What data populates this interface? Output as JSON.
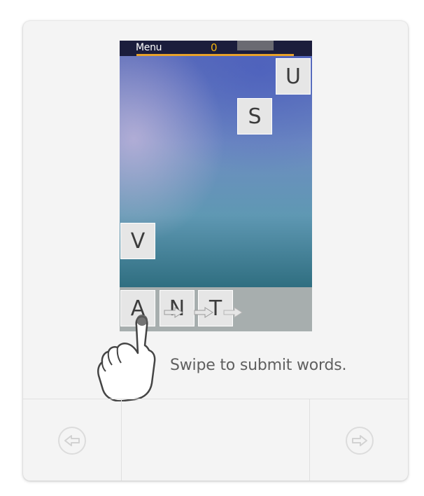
{
  "game": {
    "menu_label": "Menu",
    "score": "0",
    "falling_tiles": [
      {
        "letter": "U"
      },
      {
        "letter": "S"
      },
      {
        "letter": "V"
      }
    ],
    "tray_tiles": [
      {
        "letter": "A"
      },
      {
        "letter": "N"
      },
      {
        "letter": "T"
      }
    ]
  },
  "tutorial": {
    "caption": "Swipe to submit words."
  },
  "navigation": {
    "prev_icon": "arrow-left-circle-icon",
    "next_icon": "arrow-right-circle-icon"
  },
  "colors": {
    "score": "#f2b30c",
    "progress_bar": "#e7a12a",
    "topbar": "#1b1d3c"
  }
}
